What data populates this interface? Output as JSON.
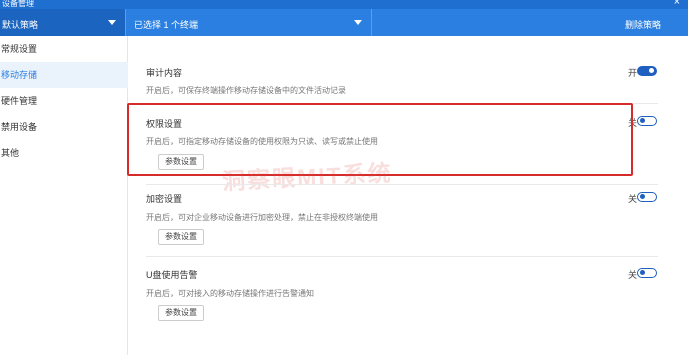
{
  "window": {
    "title": "设备管理",
    "close_glyph": "×"
  },
  "topbar": {
    "policy": "默认策略",
    "selected_text": "已选择 1 个终端",
    "delete_label": "删除策略"
  },
  "sidebar": {
    "items": [
      {
        "label": "常规设置",
        "active": false
      },
      {
        "label": "移动存储",
        "active": true
      },
      {
        "label": "硬件管理",
        "active": false
      },
      {
        "label": "禁用设备",
        "active": false
      },
      {
        "label": "其他",
        "active": false
      }
    ]
  },
  "sections": [
    {
      "title": "审计内容",
      "desc": "开启后，可保存终端操作移动存储设备中的文件活动记录",
      "toggle_label": "开",
      "on": true,
      "has_param": false
    },
    {
      "title": "权限设置",
      "desc": "开启后，可指定移动存储设备的使用权限为只读、读写或禁止使用",
      "toggle_label": "关",
      "on": false,
      "has_param": true,
      "param_label": "参数设置"
    },
    {
      "title": "加密设置",
      "desc": "开启后，可对企业移动设备进行加密处理，禁止在非授权终端使用",
      "toggle_label": "关",
      "on": false,
      "has_param": true,
      "param_label": "参数设置"
    },
    {
      "title": "U盘使用告警",
      "desc": "开启后，可对接入的移动存储操作进行告警通知",
      "toggle_label": "关",
      "on": false,
      "has_param": true,
      "param_label": "参数设置"
    }
  ],
  "watermark": "洞察眼MIT系统",
  "colors": {
    "accent": "#2a7fe0",
    "dark_accent": "#1b64bf",
    "highlight": "#d62b2b"
  }
}
